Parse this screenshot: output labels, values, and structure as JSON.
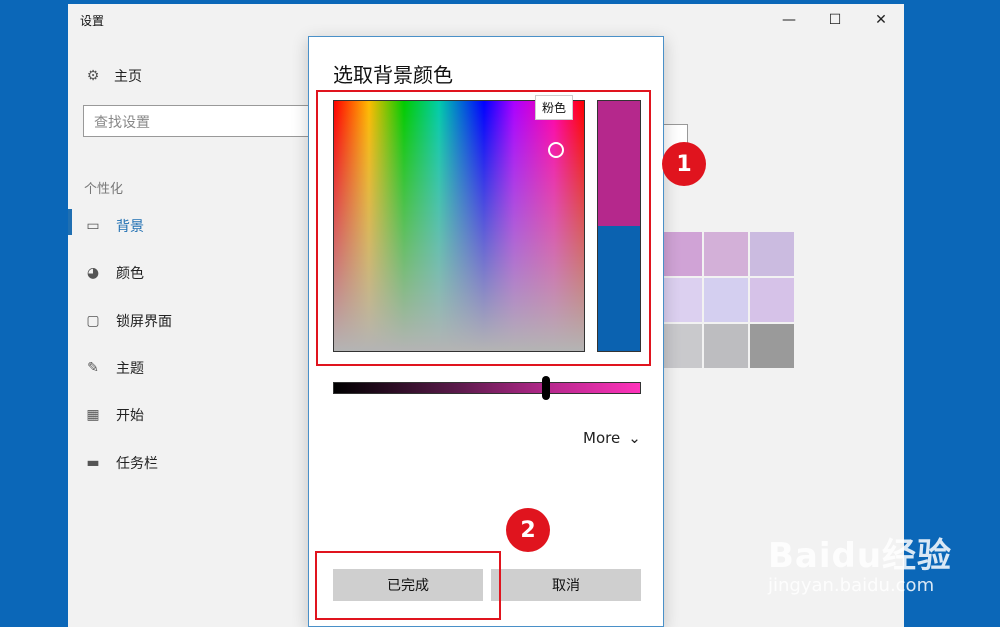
{
  "window": {
    "title": "设置",
    "controls": {
      "minimize": "—",
      "maximize": "☐",
      "close": "✕"
    }
  },
  "nav": {
    "home": "主页",
    "search_placeholder": "查找设置",
    "section": "个性化",
    "items": [
      {
        "label": "背景",
        "icon": "image-icon",
        "active": true
      },
      {
        "label": "颜色",
        "icon": "palette-icon",
        "active": false
      },
      {
        "label": "锁屏界面",
        "icon": "lockscreen-icon",
        "active": false
      },
      {
        "label": "主题",
        "icon": "theme-icon",
        "active": false
      },
      {
        "label": "开始",
        "icon": "start-icon",
        "active": false
      },
      {
        "label": "任务栏",
        "icon": "taskbar-icon",
        "active": false
      }
    ]
  },
  "swatch_colors": [
    "#d0a3d6",
    "#d3b0d8",
    "#cbbbe0",
    "#dcd0f0",
    "#d4cff0",
    "#d6c2e8",
    "#c9c9cc",
    "#bdbdc0",
    "#9a9a9a"
  ],
  "dialog": {
    "title": "选取背景颜色",
    "tooltip": "粉色",
    "more_label": "More",
    "done_label": "已完成",
    "cancel_label": "取消",
    "preview_new_color": "#b5288c",
    "preview_old_color": "#0b62b0",
    "brightness_level": 0.69
  },
  "annotations": {
    "one": "1",
    "two": "2"
  },
  "watermark": {
    "brand": "Baidu经验",
    "url": "jingyan.baidu.com"
  }
}
